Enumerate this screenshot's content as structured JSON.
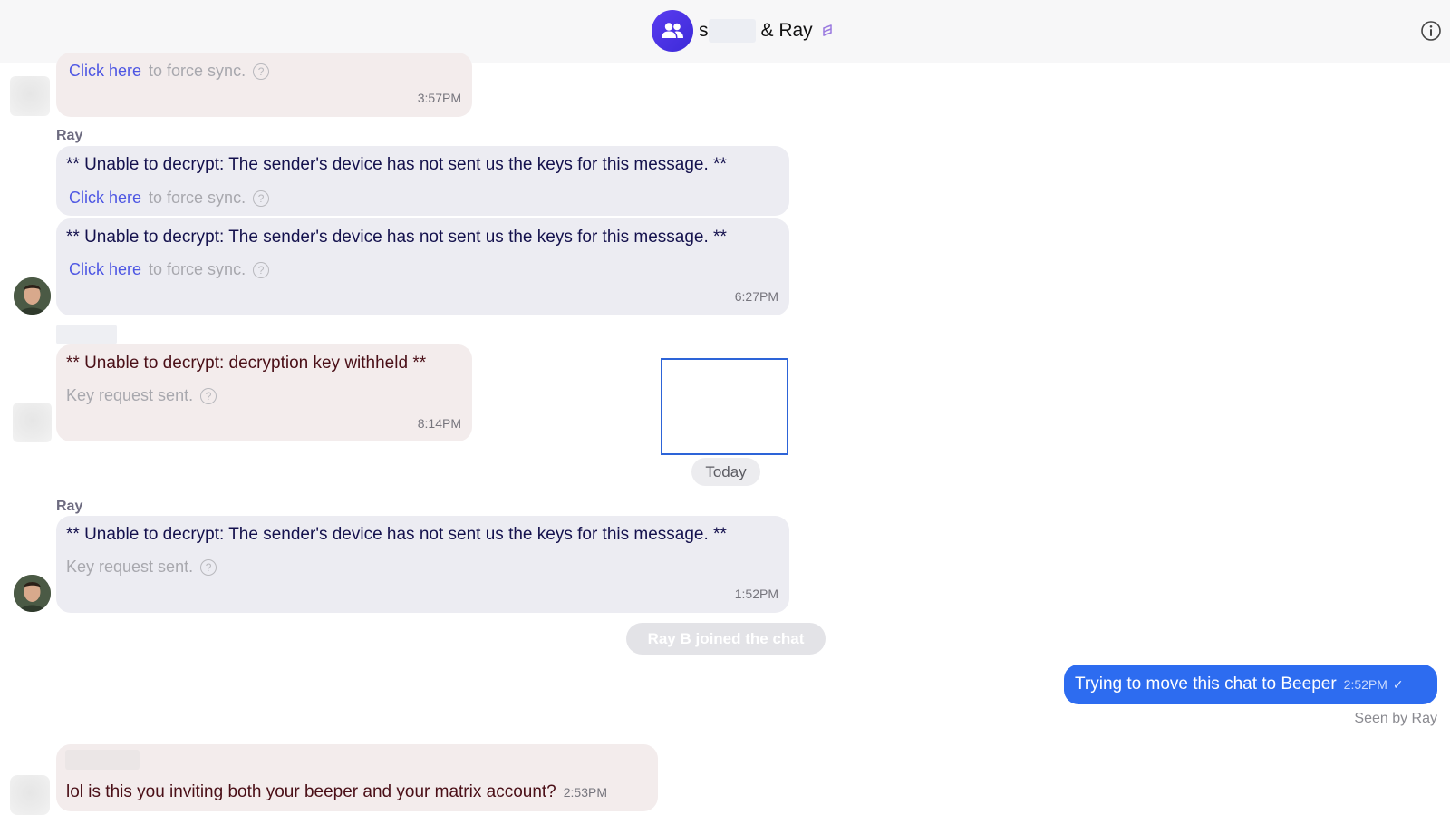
{
  "header": {
    "title_start": "s",
    "title_end": "& Ray",
    "bridge_icon": "bridge-link-icon",
    "info_icon": "info-icon"
  },
  "messages": [
    {
      "link": "Click here",
      "hint": "to force sync.",
      "time": "3:57PM"
    },
    {
      "sender": "Ray",
      "text": "** Unable to decrypt: The sender's device has not sent us the keys for this message. **",
      "link": "Click here",
      "hint": "to force sync."
    },
    {
      "text": "** Unable to decrypt: The sender's device has not sent us the keys for this message. **",
      "link": "Click here",
      "hint": "to force sync.",
      "time": "6:27PM"
    },
    {
      "text": "** Unable to decrypt: decryption key withheld **",
      "hint": "Key request sent.",
      "time": "8:14PM"
    },
    {
      "sender": "Ray",
      "text": "** Unable to decrypt: The sender's device has not sent us the keys for this message. **",
      "hint": "Key request sent.",
      "time": "1:52PM"
    },
    {
      "text": "lol is this you inviting both your beeper and your matrix account?",
      "time": "2:53PM"
    }
  ],
  "day_divider": "Today",
  "system_event": "Ray B joined the chat",
  "outgoing": {
    "text": "Trying to move this chat to Beeper",
    "time": "2:52PM",
    "status_icon": "check-icon",
    "read_receipt": "Seen by Ray"
  },
  "colors": {
    "accent": "#2d6cf0",
    "group_avatar": "#4b33e6",
    "link": "#4d56e3",
    "incoming_pink": "#f3ecec",
    "incoming_lavender": "#ececf2"
  }
}
